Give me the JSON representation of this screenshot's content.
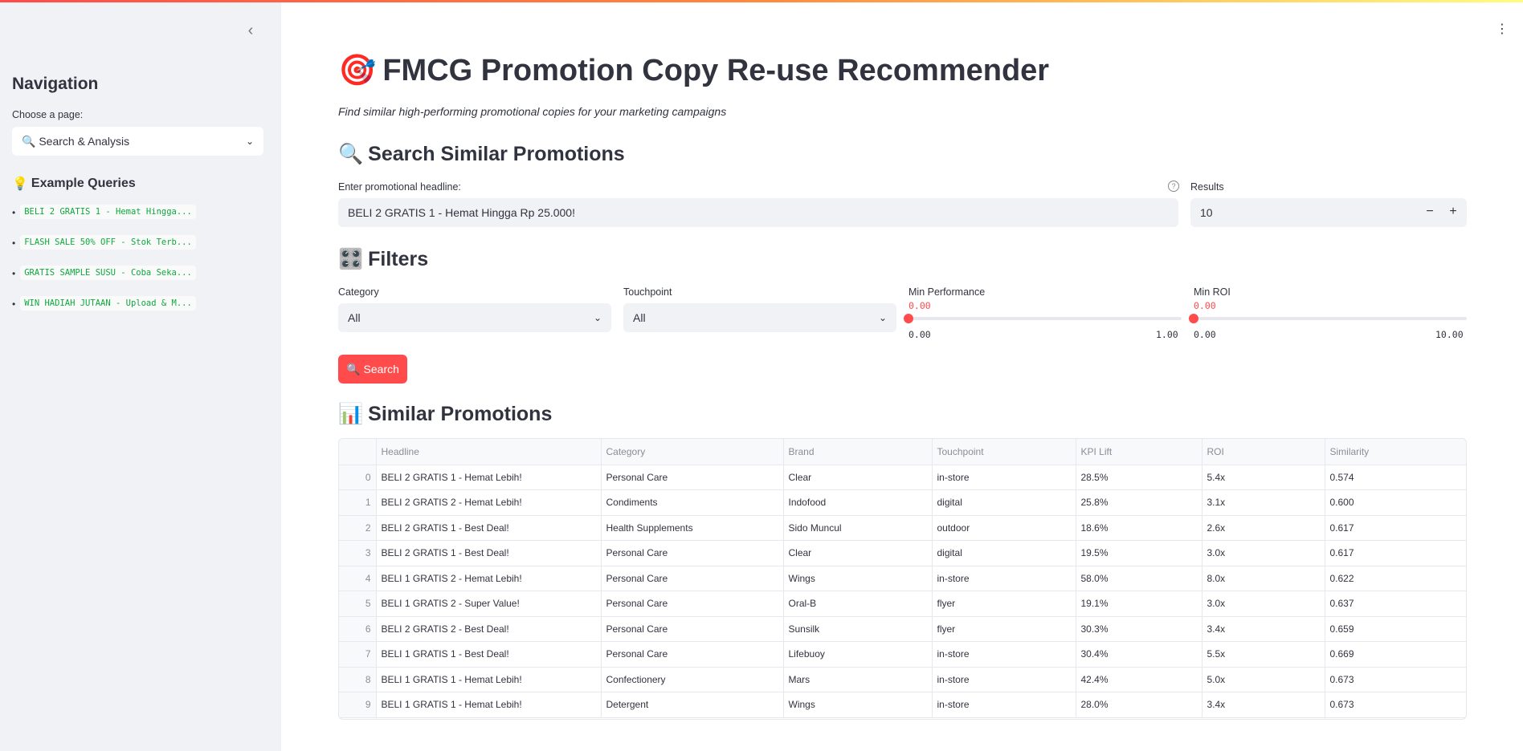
{
  "sidebar": {
    "collapse_icon": "chevron-left-icon",
    "nav_title": "Navigation",
    "choose_label": "Choose a page:",
    "page_select_value": "🔍 Search & Analysis",
    "examples_icon": "💡",
    "examples_title": "Example Queries",
    "examples": [
      "BELI 2 GRATIS 1 - Hemat Hingga...",
      "FLASH SALE 50% OFF - Stok Terb...",
      "GRATIS SAMPLE SUSU - Coba Seka...",
      "WIN HADIAH JUTAAN - Upload & M..."
    ]
  },
  "main": {
    "title_icon": "🎯",
    "title": "FMCG Promotion Copy Re-use Recommender",
    "subtitle": "Find similar high-performing promotional copies for your marketing campaigns",
    "search_section": {
      "icon": "🔍",
      "title": "Search Similar Promotions",
      "headline_label": "Enter promotional headline:",
      "headline_value": "BELI 2 GRATIS 1 - Hemat Hingga Rp 25.000!",
      "results_label": "Results",
      "results_value": "10",
      "minus": "−",
      "plus": "+"
    },
    "filters": {
      "icon": "🎛️",
      "title": "Filters",
      "category_label": "Category",
      "category_value": "All",
      "touchpoint_label": "Touchpoint",
      "touchpoint_value": "All",
      "min_perf_label": "Min Performance",
      "min_perf_value": "0.00",
      "min_perf_min": "0.00",
      "min_perf_max": "1.00",
      "min_roi_label": "Min ROI",
      "min_roi_value": "0.00",
      "min_roi_min": "0.00",
      "min_roi_max": "10.00"
    },
    "search_button_icon": "🔍",
    "search_button": "Search",
    "results_section": {
      "icon": "📊",
      "title": "Similar Promotions",
      "columns": [
        "",
        "Headline",
        "Category",
        "Brand",
        "Touchpoint",
        "KPI Lift",
        "ROI",
        "Similarity"
      ],
      "rows": [
        [
          "0",
          "BELI 2 GRATIS 1 - Hemat Lebih!",
          "Personal Care",
          "Clear",
          "in-store",
          "28.5%",
          "5.4x",
          "0.574"
        ],
        [
          "1",
          "BELI 2 GRATIS 2 - Hemat Lebih!",
          "Condiments",
          "Indofood",
          "digital",
          "25.8%",
          "3.1x",
          "0.600"
        ],
        [
          "2",
          "BELI 2 GRATIS 1 - Best Deal!",
          "Health Supplements",
          "Sido Muncul",
          "outdoor",
          "18.6%",
          "2.6x",
          "0.617"
        ],
        [
          "3",
          "BELI 2 GRATIS 1 - Best Deal!",
          "Personal Care",
          "Clear",
          "digital",
          "19.5%",
          "3.0x",
          "0.617"
        ],
        [
          "4",
          "BELI 1 GRATIS 2 - Hemat Lebih!",
          "Personal Care",
          "Wings",
          "in-store",
          "58.0%",
          "8.0x",
          "0.622"
        ],
        [
          "5",
          "BELI 1 GRATIS 2 - Super Value!",
          "Personal Care",
          "Oral-B",
          "flyer",
          "19.1%",
          "3.0x",
          "0.637"
        ],
        [
          "6",
          "BELI 2 GRATIS 2 - Best Deal!",
          "Personal Care",
          "Sunsilk",
          "flyer",
          "30.3%",
          "3.4x",
          "0.659"
        ],
        [
          "7",
          "BELI 1 GRATIS 1 - Best Deal!",
          "Personal Care",
          "Lifebuoy",
          "in-store",
          "30.4%",
          "5.5x",
          "0.669"
        ],
        [
          "8",
          "BELI 1 GRATIS 1 - Hemat Lebih!",
          "Confectionery",
          "Mars",
          "in-store",
          "42.4%",
          "5.0x",
          "0.673"
        ],
        [
          "9",
          "BELI 1 GRATIS 1 - Hemat Lebih!",
          "Detergent",
          "Wings",
          "in-store",
          "28.0%",
          "3.4x",
          "0.673"
        ]
      ]
    }
  },
  "colors": {
    "accent": "#ff4b4b",
    "sidebar_bg": "#f0f2f6",
    "code_green": "#09ab3b",
    "text": "#31333f"
  }
}
